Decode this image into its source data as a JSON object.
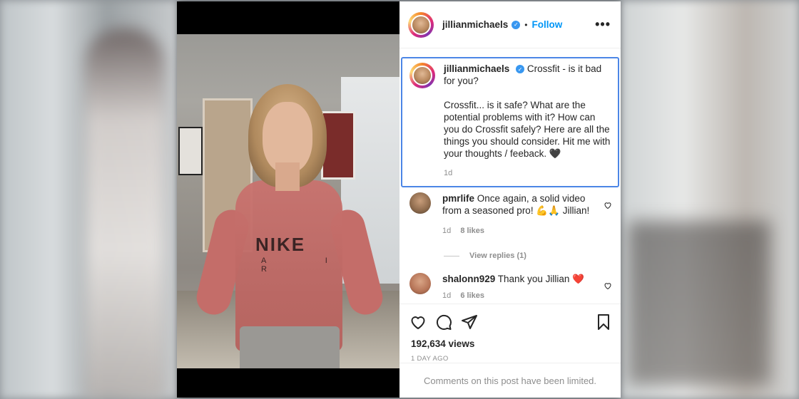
{
  "post": {
    "author": {
      "username": "jillianmichaels",
      "verified": true,
      "follow_label": "Follow",
      "separator": "•"
    },
    "more_label": "•••",
    "caption": {
      "username": "jillianmichaels",
      "title_text": "Crossfit - is it bad for you?",
      "body": "Crossfit... is it safe? What are the potential problems with it? How can you do Crossfit safely? Here are all the things you should consider. Hit me with your thoughts / feeback. 🖤",
      "time": "1d"
    },
    "comments": [
      {
        "username": "pmrlife",
        "text": "Once again, a solid video from a seasoned pro! 💪🙏 Jillian!",
        "time": "1d",
        "likes": "8 likes",
        "view_replies": "View replies (1)"
      },
      {
        "username": "shalonn929",
        "text": "Thank you Jillian ❤️",
        "time": "1d",
        "likes": "6 likes"
      }
    ],
    "video_overlay": {
      "logo_text": "NIKE",
      "logo_sub": "A I R"
    },
    "views": "192,634 views",
    "date": "1 DAY AGO",
    "comments_limited": "Comments on this post have been limited.",
    "colors": {
      "link_blue": "#0095f6",
      "verified_blue": "#3897f0",
      "caption_highlight": "#4c86e6",
      "muted_text": "#8e8e8e",
      "text": "#262626"
    },
    "icons": [
      "heart-icon",
      "comment-icon",
      "share-icon",
      "bookmark-icon",
      "more-icon",
      "verified-icon"
    ]
  }
}
